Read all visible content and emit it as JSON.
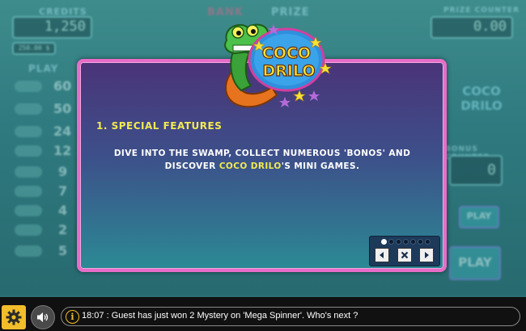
{
  "background": {
    "credits_label": "CREDITS",
    "credits_value": "1,250",
    "credits_sub": "250.00 $",
    "bank_label": "BANK",
    "prize_label": "PRIZE",
    "prize_counter_label": "PRIZE COUNTER",
    "prize_counter_value": "0.00",
    "bonus_counter_label": "BONUS COUNTER",
    "bonus_counter_value": "0",
    "play_label": "PLAY",
    "pay_numbers": [
      "60",
      "50",
      "24",
      "12",
      "9",
      "7",
      "4",
      "2",
      "5"
    ],
    "play_button": "PLAY",
    "play_small_button": "PLAY",
    "logo_text": "COCO DRILO"
  },
  "modal": {
    "logo_line1": "COCO",
    "logo_line2": "DRILO",
    "section_title": "1. SPECIAL FEATURES",
    "desc_line1": "DIVE INTO THE SWAMP, COLLECT NUMEROUS 'BONOS' AND",
    "desc_line2_pre": "DISCOVER ",
    "desc_line2_highlight": "COCO DRILO",
    "desc_line2_post": "'S MINI GAMES.",
    "pager": {
      "current_page": 1,
      "total_pages": 7
    }
  },
  "bottom_bar": {
    "ticker_message": "18:07 : Guest has just won 2 Mystery on 'Mega Spinner'. Who's next ?"
  },
  "icons": [
    "gear-icon",
    "speaker-icon",
    "info-icon",
    "arrow-left-icon",
    "close-icon",
    "arrow-right-icon"
  ],
  "colors": {
    "accent_yellow": "#f1ea52",
    "modal_border": "#e86dc8",
    "settings_button": "#f2bd2a"
  }
}
